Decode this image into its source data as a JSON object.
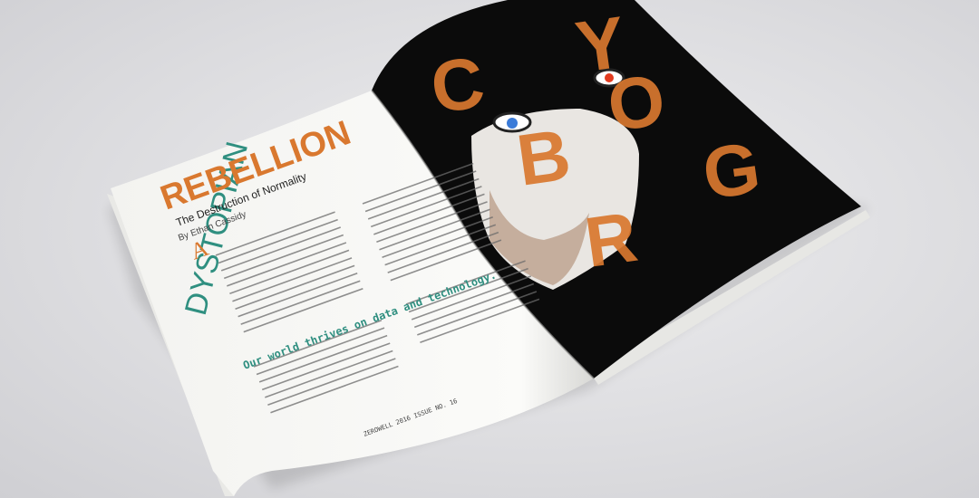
{
  "magazine": {
    "colors": {
      "accent": "#d9782f",
      "teal": "#2f8f80",
      "black": "#0b0b0b",
      "paper": "#fbfbf9"
    },
    "left_page": {
      "headline_vertical": "DYSTOPIAN",
      "headline_main": "REBELLION",
      "subtitle": "The Destruction of Normality",
      "byline": "By Ethan Cassidy",
      "drop_cap": "A",
      "pull_quote": "Our world thrives on data and technology.",
      "footer": "ZEROWELL 2016 ISSUE NO. 16"
    },
    "right_page": {
      "letters": [
        "C",
        "Y",
        "B",
        "O",
        "R",
        "G"
      ]
    }
  }
}
